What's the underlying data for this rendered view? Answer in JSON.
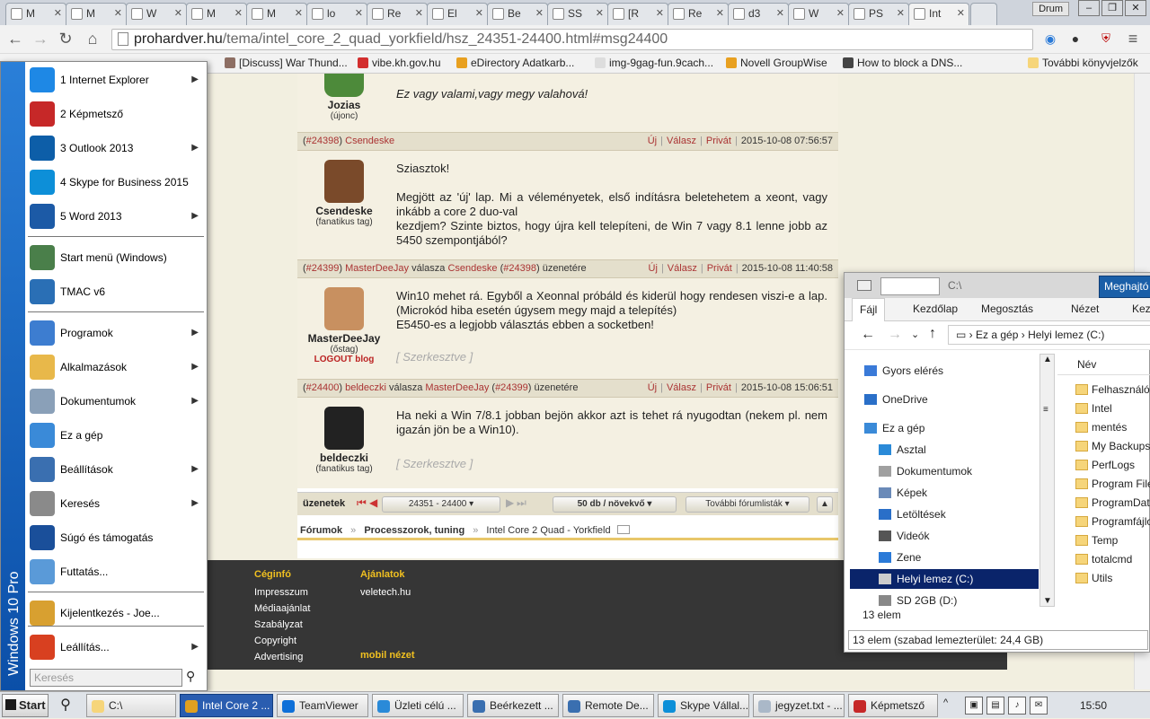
{
  "browser": {
    "tabs": [
      {
        "label": "M"
      },
      {
        "label": "M"
      },
      {
        "label": "W"
      },
      {
        "label": "M"
      },
      {
        "label": "M"
      },
      {
        "label": "lo"
      },
      {
        "label": "Re"
      },
      {
        "label": "El"
      },
      {
        "label": "Be"
      },
      {
        "label": "SS"
      },
      {
        "label": "[R"
      },
      {
        "label": "Re"
      },
      {
        "label": "d3"
      },
      {
        "label": "W"
      },
      {
        "label": "PS"
      },
      {
        "label": "Int"
      }
    ],
    "profile": "Drum",
    "url_domain": "prohardver.hu",
    "url_path": "/tema/intel_core_2_quad_yorkfield/hsz_24351-24400.html#msg24400",
    "bookmarks": [
      {
        "label": "[Discuss] War Thund...",
        "color": "#8d6e63"
      },
      {
        "label": "vibe.kh.gov.hu",
        "color": "#d32f2f"
      },
      {
        "label": "eDirectory Adatkarb...",
        "color": "#e8a020"
      },
      {
        "label": "img-9gag-fun.9cach...",
        "color": "#dddddd"
      },
      {
        "label": "Novell GroupWise",
        "color": "#e8a020"
      },
      {
        "label": "How to block a DNS...",
        "color": "#444444"
      },
      {
        "label": "További könyvjelzők",
        "color": "#f6d57a"
      }
    ]
  },
  "forum": {
    "first_post": {
      "username": "Jozias",
      "rank": "(újonc)",
      "text": "Ez vagy valami,vagy megy valahová!"
    },
    "post_actions": {
      "new": "Új",
      "reply": "Válasz",
      "private": "Privát"
    },
    "posts": [
      {
        "num": "#24398",
        "author": "Csendeske",
        "reply_word": "",
        "reply_to": "",
        "reply_num": "",
        "reply_suffix": "",
        "date": "2015-10-08 07:56:57",
        "username": "Csendeske",
        "rank": "(fanatikus tag)",
        "blog": "",
        "text": "Sziasztok!\n\nMegjött az 'új' lap. Mi a véleményetek, első indításra beletehetem a xeont, vagy inkább a core 2 duo-val\nkezdjem? Szinte biztos, hogy újra kell telepíteni, de Win 7 vagy 8.1 lenne jobb az 5450 szempontjából?",
        "edit": ""
      },
      {
        "num": "#24399",
        "author": "MasterDeeJay",
        "reply_word": "válasza",
        "reply_to": "Csendeske",
        "reply_num": "#24398",
        "reply_suffix": "üzenetére",
        "date": "2015-10-08 11:40:58",
        "username": "MasterDeeJay",
        "rank": "(őstag)",
        "blog": "LOGOUT blog",
        "text": "Win10 mehet rá. Egyből a Xeonnal próbáld és kiderül hogy rendesen viszi-e a lap. (Microkód hiba esetén úgysem megy majd a telepítés)\nE5450-es a legjobb választás ebben a socketben!",
        "edit": "[ Szerkesztve ]"
      },
      {
        "num": "#24400",
        "author": "beldeczki",
        "reply_word": "válasza",
        "reply_to": "MasterDeeJay",
        "reply_num": "#24399",
        "reply_suffix": "üzenetére",
        "date": "2015-10-08 15:06:51",
        "username": "beldeczki",
        "rank": "(fanatikus tag)",
        "blog": "",
        "text": "Ha neki a Win 7/8.1 jobban bejön akkor azt is tehet rá nyugodtan (nekem pl. nem igazán jön be a Win10).",
        "edit": "[ Szerkesztve ]"
      }
    ],
    "pager": {
      "label": "üzenetek",
      "range": "24351 - 24400",
      "per_page": "50 db / növekvő",
      "more": "További fórumlisták"
    },
    "breadcrumb": {
      "root": "Fórumok",
      "sep": "»",
      "section": "Processzorok, tuning",
      "topic": "Intel Core 2 Quad - Yorkfield"
    },
    "footer": {
      "col1_title": "Céginfó",
      "col1": [
        "Impresszum",
        "Médiaajánlat",
        "Szabályzat",
        "Copyright",
        "Advertising"
      ],
      "col2_title": "Ajánlatok",
      "col2": [
        "veletech.hu"
      ],
      "mobile": "mobil nézet"
    }
  },
  "start_menu": {
    "band": "Windows 10 Pro",
    "items": [
      {
        "label": "1 Internet Explorer",
        "arrow": true,
        "color": "#1e88e5"
      },
      {
        "label": "2 Képmetsző",
        "arrow": false,
        "color": "#c62828"
      },
      {
        "label": "3 Outlook 2013",
        "arrow": true,
        "color": "#0d5ea8"
      },
      {
        "label": "4 Skype for Business 2015",
        "arrow": false,
        "color": "#0d8fd8"
      },
      {
        "label": "5 Word 2013",
        "arrow": true,
        "color": "#1c5aa6"
      },
      {
        "label": "Start menü (Windows)",
        "arrow": false,
        "color": "#4a7f4a"
      },
      {
        "label": "TMAC v6",
        "arrow": false,
        "color": "#2a6fb5"
      },
      {
        "label": "Programok",
        "arrow": true,
        "color": "#3d7dd0"
      },
      {
        "label": "Alkalmazások",
        "arrow": true,
        "color": "#e8b84a"
      },
      {
        "label": "Dokumentumok",
        "arrow": true,
        "color": "#8aa0b8"
      },
      {
        "label": "Ez a gép",
        "arrow": false,
        "color": "#3a8ad8"
      },
      {
        "label": "Beállítások",
        "arrow": true,
        "color": "#3a6fb0"
      },
      {
        "label": "Keresés",
        "arrow": true,
        "color": "#8a8a8a"
      },
      {
        "label": "Súgó és támogatás",
        "arrow": false,
        "color": "#1a4f9a"
      },
      {
        "label": "Futtatás...",
        "arrow": false,
        "color": "#5a9ad8"
      },
      {
        "label": "Kijelentkezés - Joe...",
        "arrow": false,
        "color": "#d8a030"
      },
      {
        "label": "Leállítás...",
        "arrow": true,
        "color": "#d84020"
      }
    ],
    "search_placeholder": "Keresés"
  },
  "explorer": {
    "title": "C:\\",
    "manage": "Meghajtó",
    "ribbon": [
      "Fájl",
      "Kezdőlap",
      "Megosztás",
      "Nézet",
      "Keze"
    ],
    "address": [
      "Ez a gép",
      "Helyi lemez (C:)"
    ],
    "nav": [
      {
        "label": "Gyors elérés",
        "color": "#3a7ad8"
      },
      {
        "label": "OneDrive",
        "color": "#2a6fc8"
      },
      {
        "label": "Ez a gép",
        "color": "#3a8ad8"
      },
      {
        "label": "Asztal",
        "color": "#2a8ad8"
      },
      {
        "label": "Dokumentumok",
        "color": "#a0a0a0"
      },
      {
        "label": "Képek",
        "color": "#6a8ab8"
      },
      {
        "label": "Letöltések",
        "color": "#2a6fc8"
      },
      {
        "label": "Videók",
        "color": "#555555"
      },
      {
        "label": "Zene",
        "color": "#2a7ad8"
      },
      {
        "label": "Helyi lemez (C:)",
        "color": "#cccccc"
      },
      {
        "label": "SD 2GB (D:)",
        "color": "#888888"
      }
    ],
    "column_header": "Név",
    "files": [
      "Felhasználók",
      "Intel",
      "mentés",
      "My Backups",
      "PerfLogs",
      "Program Files",
      "ProgramData",
      "Programfájlok",
      "Temp",
      "totalcmd",
      "Utils"
    ],
    "count": "13 elem",
    "status": "13 elem (szabad lemezterület: 24,4 GB)"
  },
  "taskbar": {
    "start": "Start",
    "items": [
      {
        "label": "C:\\",
        "color": "#f6d57a"
      },
      {
        "label": "Intel Core 2 ...",
        "color": "#e0a020"
      },
      {
        "label": "TeamViewer",
        "color": "#0e6fd8"
      },
      {
        "label": "Üzleti célú ...",
        "color": "#2a8ad8"
      },
      {
        "label": "Beérkezett ...",
        "color": "#3a6fb0"
      },
      {
        "label": "Remote De...",
        "color": "#3a6fb0"
      },
      {
        "label": "Skype Vállal...",
        "color": "#0d8fd8"
      },
      {
        "label": "jegyzet.txt - ...",
        "color": "#aab8c8"
      },
      {
        "label": "Képmetsző",
        "color": "#c62828"
      }
    ],
    "time": "15:50"
  }
}
